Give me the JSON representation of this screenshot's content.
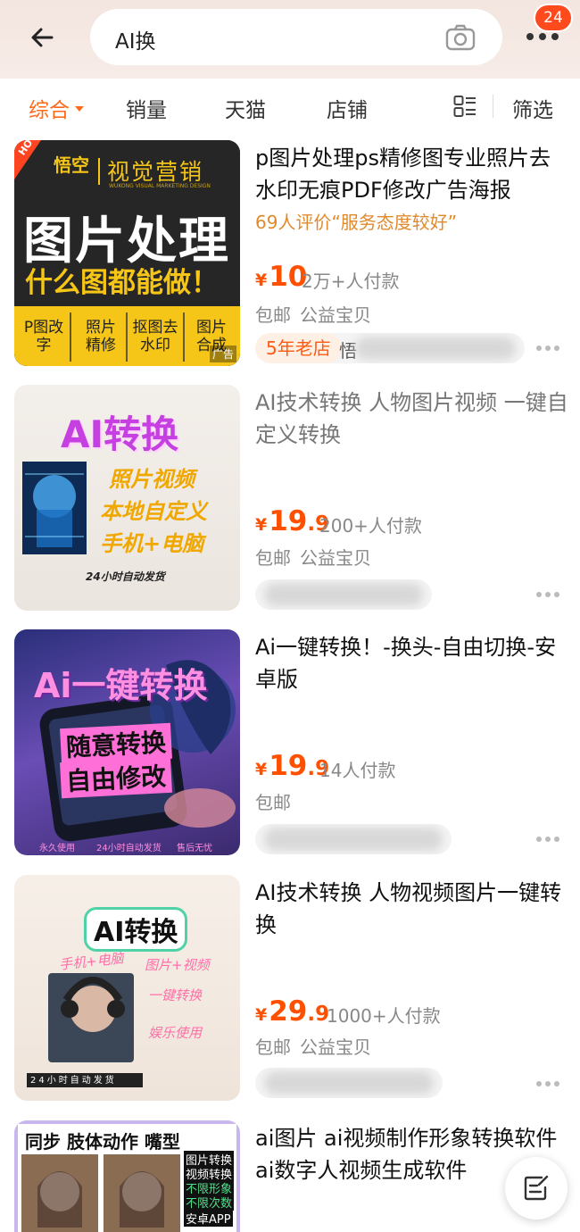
{
  "header": {
    "search_query": "AI换",
    "cart_badge": "24"
  },
  "filters": {
    "tabs": [
      {
        "label": "综合",
        "active": true
      },
      {
        "label": "销量"
      },
      {
        "label": "天猫"
      },
      {
        "label": "店铺"
      },
      {
        "label": "筛选"
      }
    ]
  },
  "products": [
    {
      "title": "p图片处理ps精修图专业照片去水印无痕PDF修改广告海报",
      "review": "69人评价“服务态度较好”",
      "price_int": "10",
      "price_dec": "",
      "sold": "2万+人付款",
      "tags": [
        "包邮",
        "公益宝贝"
      ],
      "shop_badge": "5年老店",
      "thumb": {
        "brand": "视觉营销",
        "brand_sub": "WUKONG VISUAL MARKETING DESIGN",
        "logo": "悟空",
        "headline": "图片处理",
        "sub": "什么图都能做！",
        "services": [
          "P图改字",
          "照片精修",
          "抠图去水印",
          "图片合成"
        ],
        "hot": "HOT",
        "ad": "广告"
      }
    },
    {
      "title": "AI技术转换 人物图片视频 一键自定义转换",
      "price_int": "19",
      "price_dec": ".9",
      "sold": "200+人付款",
      "tags": [
        "包邮",
        "公益宝贝"
      ],
      "thumb": {
        "headline": "AI转换",
        "lines": [
          "照片视频",
          "本地自定义",
          "手机+电脑"
        ],
        "footer": "24小时自动发货"
      }
    },
    {
      "title": "Ai一键转换！-换头-自由切换-安卓版",
      "price_int": "19",
      "price_dec": ".9",
      "sold": "14人付款",
      "tags": [
        "包邮"
      ],
      "thumb": {
        "headline": "Ai一键转换",
        "lines": [
          "随意转换",
          "自由修改"
        ],
        "footer": [
          "永久使用",
          "24小时自动发货",
          "售后无忧"
        ]
      }
    },
    {
      "title": "AI技术转换  人物视频图片一键转换",
      "price_int": "29",
      "price_dec": ".9",
      "sold": "1000+人付款",
      "tags": [
        "包邮",
        "公益宝贝"
      ],
      "thumb": {
        "headline": "AI转换",
        "lines": [
          "手机+电脑",
          "图片+视频",
          "一键转换",
          "娱乐使用"
        ],
        "footer": "24小时自动发货"
      }
    },
    {
      "title": "ai图片 ai视频制作形象转换软件 ai数字人视频生成软件",
      "thumb": {
        "headline": "同步 肢体动作 嘴型",
        "tags": [
          "图片转换",
          "视频转换",
          "不限形象",
          "不限次数",
          "安卓APP"
        ]
      }
    }
  ]
}
